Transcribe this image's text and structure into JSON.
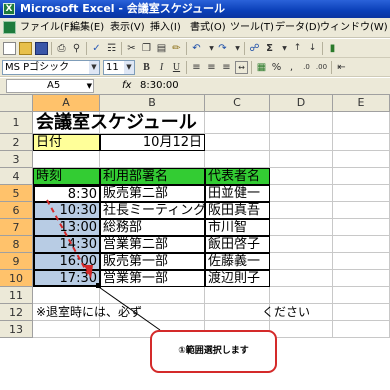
{
  "window": {
    "app_icon": "excel-icon",
    "title": "Microsoft Excel - 会議室スケジュール"
  },
  "menu": [
    "ファイル(F)",
    "編集(E)",
    "表示(V)",
    "挿入(I)",
    "書式(O)",
    "ツール(T)",
    "データ(D)",
    "ウィンドウ(W)"
  ],
  "toolbar": {
    "font_name": "MS Pゴシック",
    "font_size": "11",
    "bold_label": "B",
    "italic_label": "I",
    "underline_label": "U",
    "percent_label": "%",
    "comma_label": ","
  },
  "formula_bar": {
    "name_box": "A5",
    "fx_label": "fx",
    "value": "8:30:00"
  },
  "columns": [
    "A",
    "B",
    "C",
    "D",
    "E"
  ],
  "rows": [
    "1",
    "2",
    "3",
    "4",
    "5",
    "6",
    "7",
    "8",
    "9",
    "10",
    "11",
    "12",
    "13"
  ],
  "sheet": {
    "title": "会議室スケジュール",
    "date_label": "日付",
    "date_value": "10月12日",
    "headers": [
      "時刻",
      "利用部署名",
      "代表者名"
    ],
    "records": [
      {
        "time": "8:30",
        "dept": "販売第二部",
        "rep": "田並健一"
      },
      {
        "time": "10:30",
        "dept": "社長ミーティング",
        "rep": "阪田真吾"
      },
      {
        "time": "13:00",
        "dept": "総務部",
        "rep": "市川智"
      },
      {
        "time": "14:30",
        "dept": "営業第二部",
        "rep": "飯田啓子"
      },
      {
        "time": "16:00",
        "dept": "販売第一部",
        "rep": "佐藤義一"
      },
      {
        "time": "17:30",
        "dept": "営業第一部",
        "rep": "渡辺則子"
      }
    ],
    "note": "※退室時には、必ず",
    "note_end": "ください"
  },
  "callout": {
    "text": "①範囲選択します"
  },
  "colors": {
    "title_bar": "#0a3fb8",
    "header_fill": "#33cc33",
    "date_fill": "#ffff99",
    "selection_fill": "#b8cce4",
    "callout_border": "#d42a2a"
  }
}
